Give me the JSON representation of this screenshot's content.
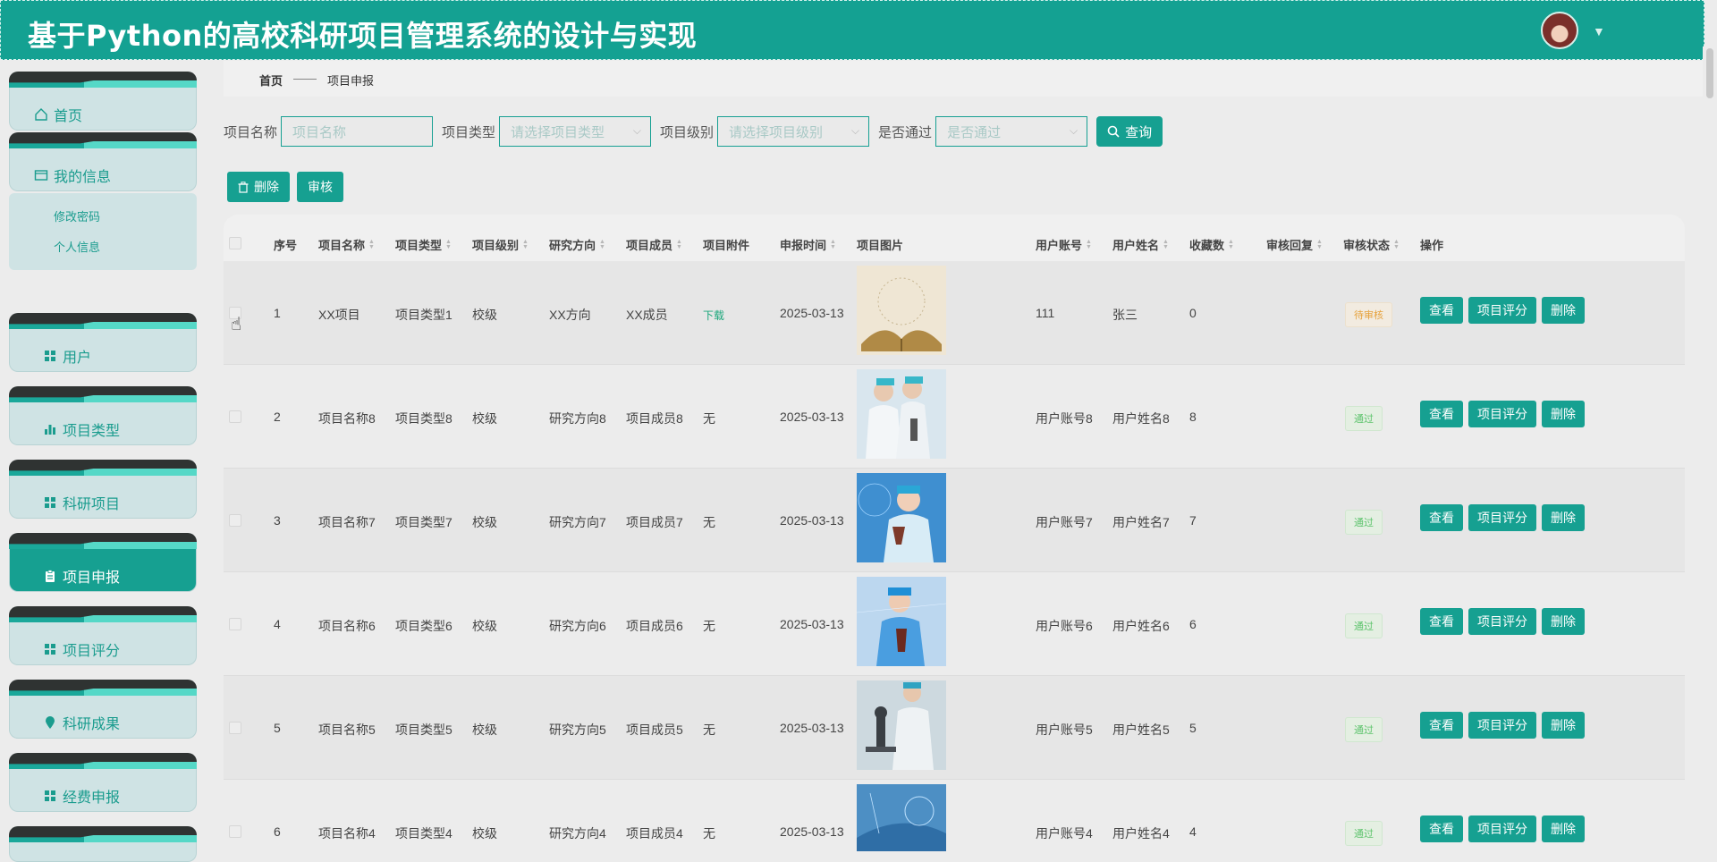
{
  "header": {
    "title": "基于Python的高校科研项目管理系统的设计与实现"
  },
  "sidebar": {
    "items": [
      {
        "label": "首页"
      },
      {
        "label": "我的信息"
      },
      {
        "label": "用户"
      },
      {
        "label": "项目类型"
      },
      {
        "label": "科研项目"
      },
      {
        "label": "项目申报"
      },
      {
        "label": "项目评分"
      },
      {
        "label": "科研成果"
      },
      {
        "label": "经费申报"
      }
    ],
    "sub_items": [
      {
        "label": "修改密码"
      },
      {
        "label": "个人信息"
      }
    ]
  },
  "breadcrumb": {
    "home": "首页",
    "sep": "——",
    "current": "项目申报"
  },
  "search": {
    "name_label": "项目名称",
    "name_placeholder": "项目名称",
    "type_label": "项目类型",
    "type_placeholder": "请选择项目类型",
    "level_label": "项目级别",
    "level_placeholder": "请选择项目级别",
    "pass_label": "是否通过",
    "pass_placeholder": "是否通过",
    "query_label": "查询"
  },
  "actions": {
    "delete_label": "删除",
    "review_label": "审核"
  },
  "table": {
    "headers": [
      "序号",
      "项目名称",
      "项目类型",
      "项目级别",
      "研究方向",
      "项目成员",
      "项目附件",
      "申报时间",
      "项目图片",
      "用户账号",
      "用户姓名",
      "收藏数",
      "审核回复",
      "审核状态",
      "操作"
    ],
    "rows": [
      {
        "no": "1",
        "name": "XX项目",
        "type": "项目类型1",
        "level": "校级",
        "dir": "XX方向",
        "member": "XX成员",
        "attach": "下载",
        "time": "2025-03-13",
        "account": "111",
        "user": "张三",
        "fav": "0",
        "reply": "",
        "status": "待审核"
      },
      {
        "no": "2",
        "name": "项目名称8",
        "type": "项目类型8",
        "level": "校级",
        "dir": "研究方向8",
        "member": "项目成员8",
        "attach": "无",
        "time": "2025-03-13",
        "account": "用户账号8",
        "user": "用户姓名8",
        "fav": "8",
        "reply": "",
        "status": "通过"
      },
      {
        "no": "3",
        "name": "项目名称7",
        "type": "项目类型7",
        "level": "校级",
        "dir": "研究方向7",
        "member": "项目成员7",
        "attach": "无",
        "time": "2025-03-13",
        "account": "用户账号7",
        "user": "用户姓名7",
        "fav": "7",
        "reply": "",
        "status": "通过"
      },
      {
        "no": "4",
        "name": "项目名称6",
        "type": "项目类型6",
        "level": "校级",
        "dir": "研究方向6",
        "member": "项目成员6",
        "attach": "无",
        "time": "2025-03-13",
        "account": "用户账号6",
        "user": "用户姓名6",
        "fav": "6",
        "reply": "",
        "status": "通过"
      },
      {
        "no": "5",
        "name": "项目名称5",
        "type": "项目类型5",
        "level": "校级",
        "dir": "研究方向5",
        "member": "项目成员5",
        "attach": "无",
        "time": "2025-03-13",
        "account": "用户账号5",
        "user": "用户姓名5",
        "fav": "5",
        "reply": "",
        "status": "通过"
      },
      {
        "no": "6",
        "name": "项目名称4",
        "type": "项目类型4",
        "level": "校级",
        "dir": "研究方向4",
        "member": "项目成员4",
        "attach": "无",
        "time": "2025-03-13",
        "account": "用户账号4",
        "user": "用户姓名4",
        "fav": "4",
        "reply": "",
        "status": "通过"
      }
    ],
    "row_actions": {
      "view": "查看",
      "score": "项目评分",
      "delete": "删除"
    }
  },
  "colors": {
    "primary": "#16a091",
    "header_bg": "#14a192",
    "pass": "#5cc36b",
    "wait": "#e6a23c"
  }
}
